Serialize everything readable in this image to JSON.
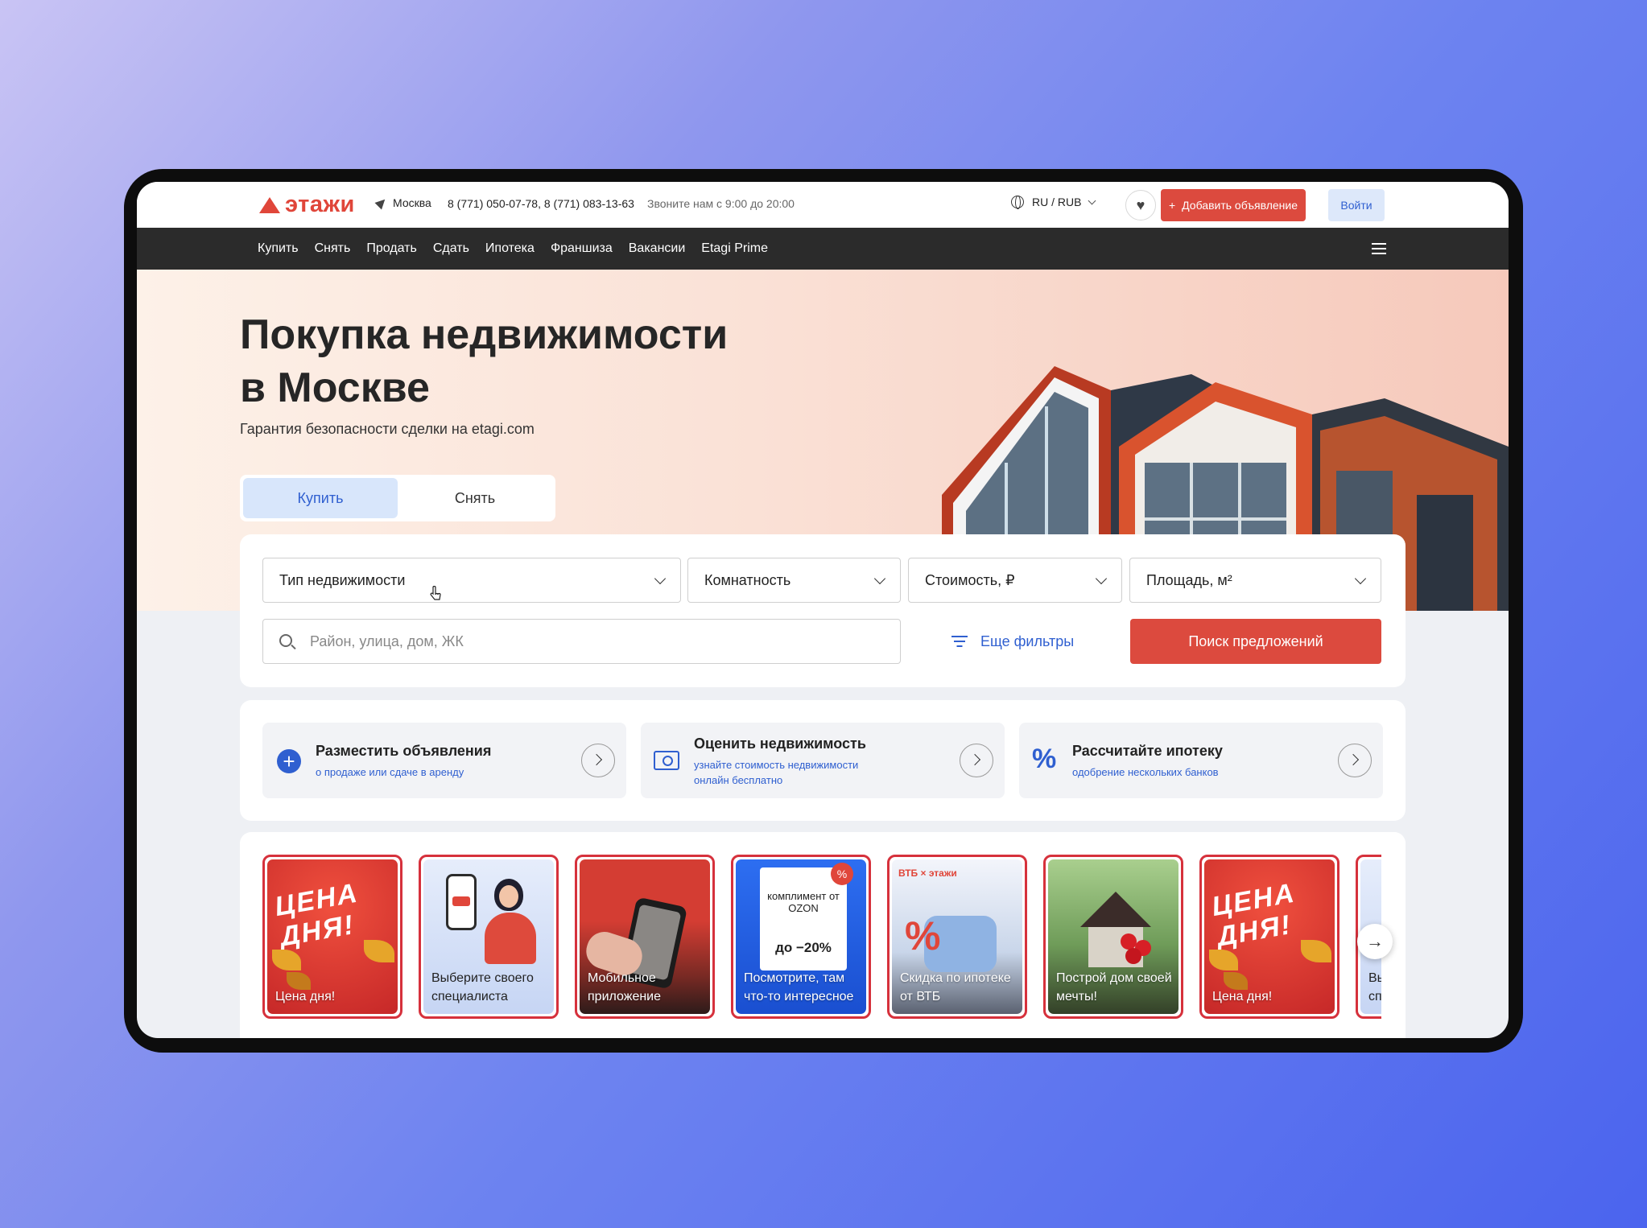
{
  "topbar": {
    "logo": "этажи",
    "city": "Москва",
    "phones": "8 (771) 050-07-78, 8 (771) 083-13-63",
    "hours": "Звоните нам с 9:00 до 20:00",
    "lang": "RU / RUB",
    "add_listing": "Добавить объявление",
    "login": "Войти"
  },
  "nav": [
    "Купить",
    "Снять",
    "Продать",
    "Сдать",
    "Ипотека",
    "Франшиза",
    "Вакансии",
    "Etagi Prime"
  ],
  "hero": {
    "title_line1": "Покупка недвижимости",
    "title_line2": "в Москве",
    "subtitle": "Гарантия безопасности сделки на etagi.com",
    "tabs": [
      "Купить",
      "Снять"
    ],
    "active_tab": "Купить"
  },
  "search": {
    "type": "Тип недвижимости",
    "rooms": "Комнатность",
    "price": "Стоимость, ₽",
    "area": "Площадь, м²",
    "address_placeholder": "Район, улица, дом, ЖК",
    "more_filters": "Еще фильтры",
    "submit": "Поиск предложений"
  },
  "services": [
    {
      "title": "Разместить объявления",
      "sub": "о продаже или сдаче в аренду"
    },
    {
      "title": "Оценить недвижимость",
      "sub": "узнайте стоимость недвижимости онлайн бесплатно"
    },
    {
      "title": "Рассчитайте ипотеку",
      "sub": "одобрение нескольких банков"
    }
  ],
  "stories": [
    {
      "caption": "Цена дня!",
      "art_text": "ЦЕНА ДНЯ!"
    },
    {
      "caption": "Выберите своего специалиста"
    },
    {
      "caption": "Мобильное приложение"
    },
    {
      "caption": "Посмотрите, там что-то интересное",
      "art_text": "комплимент от OZON",
      "art_discount": "до −20%"
    },
    {
      "caption": "Скидка по ипотеке от ВТБ",
      "art_text": "ВТБ × этажи"
    },
    {
      "caption": "Построй дом своей мечты!"
    },
    {
      "caption": "Цена дня!",
      "art_text": "ЦЕНА ДНЯ!"
    },
    {
      "caption": "Выберите своего специалиста"
    }
  ],
  "colors": {
    "brand_red": "#dc4a3e",
    "accent_blue": "#2f5fd0",
    "navbar": "#2b2b2b"
  }
}
